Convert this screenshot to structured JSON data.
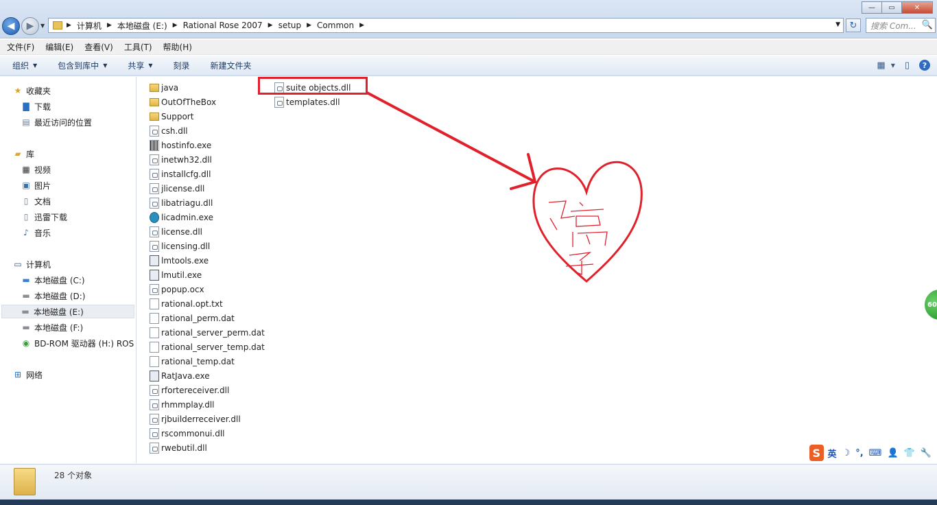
{
  "window": {
    "min_glyph": "—",
    "max_glyph": "▭",
    "close_glyph": "✕"
  },
  "address_bar": {
    "crumbs": [
      "计算机",
      "本地磁盘 (E:)",
      "Rational Rose 2007",
      "setup",
      "Common"
    ],
    "search_placeholder": "搜索 Com...",
    "arrow_glyph": "▶",
    "drop_glyph": "▼",
    "refresh_glyph": "↻",
    "search_icon_glyph": "🔍"
  },
  "menu": {
    "items": [
      "文件(F)",
      "编辑(E)",
      "查看(V)",
      "工具(T)",
      "帮助(H)"
    ]
  },
  "toolbar": {
    "organize": "组织",
    "include_library": "包含到库中",
    "share": "共享",
    "burn": "刻录",
    "new_folder": "新建文件夹",
    "drop_glyph": "▼",
    "view_icon": "▦",
    "pane_icon": "▯",
    "help": "?"
  },
  "nav": {
    "favorites": "收藏夹",
    "downloads": "下载",
    "recent": "最近访问的位置",
    "libraries": "库",
    "videos": "视频",
    "pictures": "图片",
    "documents": "文档",
    "xunlei": "迅雷下载",
    "music": "音乐",
    "computer": "计算机",
    "drive_c": "本地磁盘 (C:)",
    "drive_d": "本地磁盘 (D:)",
    "drive_e": "本地磁盘 (E:)",
    "drive_f": "本地磁盘 (F:)",
    "bdrom": "BD-ROM 驱动器 (H:) ROS",
    "network": "网络"
  },
  "files": {
    "col1": [
      {
        "name": "java",
        "icon": "folder"
      },
      {
        "name": "OutOfTheBox",
        "icon": "folder"
      },
      {
        "name": "Support",
        "icon": "folder"
      },
      {
        "name": "csh.dll",
        "icon": "dll"
      },
      {
        "name": "hostinfo.exe",
        "icon": "barcode"
      },
      {
        "name": "inetwh32.dll",
        "icon": "dll"
      },
      {
        "name": "installcfg.dll",
        "icon": "dll"
      },
      {
        "name": "jlicense.dll",
        "icon": "dll"
      },
      {
        "name": "libatriagu.dll",
        "icon": "dll"
      },
      {
        "name": "licadmin.exe",
        "icon": "magnifier"
      },
      {
        "name": "license.dll",
        "icon": "dll"
      },
      {
        "name": "licensing.dll",
        "icon": "dll"
      },
      {
        "name": "lmtools.exe",
        "icon": "exe"
      },
      {
        "name": "lmutil.exe",
        "icon": "exe"
      },
      {
        "name": "popup.ocx",
        "icon": "dll"
      },
      {
        "name": "rational.opt.txt",
        "icon": "file"
      },
      {
        "name": "rational_perm.dat",
        "icon": "file"
      },
      {
        "name": "rational_server_perm.dat",
        "icon": "file"
      },
      {
        "name": "rational_server_temp.dat",
        "icon": "file"
      },
      {
        "name": "rational_temp.dat",
        "icon": "file"
      },
      {
        "name": "RatJava.exe",
        "icon": "exe"
      },
      {
        "name": "rfortereceiver.dll",
        "icon": "dll"
      },
      {
        "name": "rhmmplay.dll",
        "icon": "dll"
      },
      {
        "name": "rjbuilderreceiver.dll",
        "icon": "dll"
      },
      {
        "name": "rscommonui.dll",
        "icon": "dll"
      },
      {
        "name": "rwebutil.dll",
        "icon": "dll"
      }
    ],
    "col2": [
      {
        "name": "suite objects.dll",
        "icon": "dll"
      },
      {
        "name": "templates.dll",
        "icon": "dll"
      }
    ]
  },
  "status": {
    "count": "28 个对象"
  },
  "ime": {
    "logo": "S",
    "mode": "英",
    "icons": [
      "☽",
      "°,",
      "⌨",
      "👤",
      "👕",
      "🔧"
    ]
  },
  "badge": "60",
  "annotation_color": "#e0212b"
}
